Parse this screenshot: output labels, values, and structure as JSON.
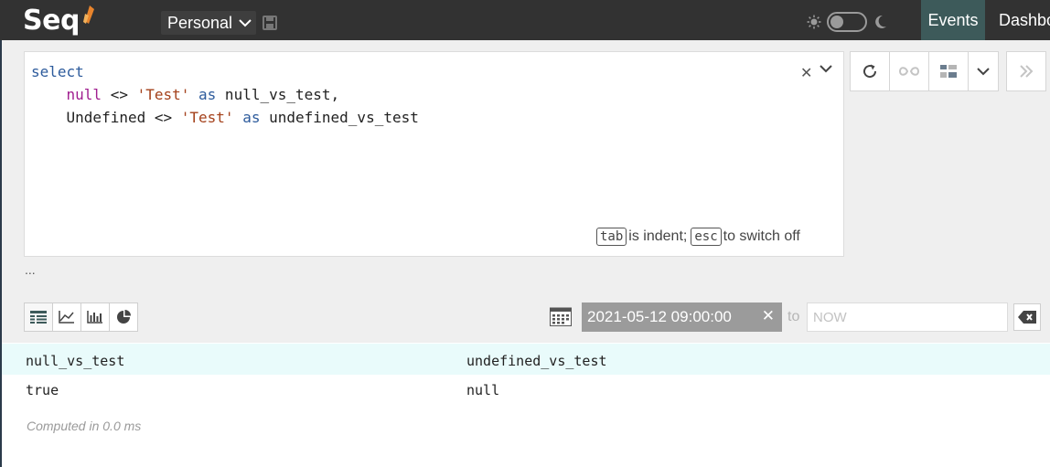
{
  "app": {
    "logo_text": "Seq",
    "workspace": "Personal"
  },
  "nav": {
    "events": "Events",
    "dashboards": "Dashbo"
  },
  "query": {
    "lines": [
      [
        {
          "t": "select",
          "c": "kw"
        }
      ],
      [
        {
          "t": "    "
        },
        {
          "t": "null",
          "c": "null"
        },
        {
          "t": " <> "
        },
        {
          "t": "'Test'",
          "c": "str"
        },
        {
          "t": " "
        },
        {
          "t": "as",
          "c": "kw"
        },
        {
          "t": " null_vs_test,"
        }
      ],
      [
        {
          "t": "    Undefined <> "
        },
        {
          "t": "'Test'",
          "c": "str"
        },
        {
          "t": " "
        },
        {
          "t": "as",
          "c": "kw"
        },
        {
          "t": " undefined_vs_test"
        }
      ]
    ],
    "hint": {
      "key1": "tab",
      "text1": "is indent;",
      "key2": "esc",
      "text2": "to switch off"
    }
  },
  "ellipsis": "...",
  "range": {
    "from": "2021-05-12 09:00:00",
    "to_label": "to",
    "to_placeholder": "NOW"
  },
  "results": {
    "columns": [
      "null_vs_test",
      "undefined_vs_test"
    ],
    "rows": [
      [
        "true",
        "null"
      ]
    ],
    "computed": "Computed in 0.0 ms"
  },
  "icons": {
    "accent": "#e8842c",
    "active_nav": "#3d5a5a",
    "table_view": "table-icon",
    "line_view": "line-chart-icon",
    "bar_view": "bar-chart-icon",
    "pie_view": "pie-chart-icon"
  }
}
